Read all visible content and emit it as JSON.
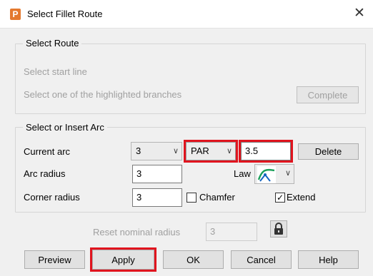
{
  "window": {
    "title": "Select Fillet Route",
    "icon_letter": "P",
    "close_glyph": "✕"
  },
  "select_route": {
    "legend": "Select Route",
    "start_line": "Select start line",
    "branches": "Select one of the highlighted branches",
    "complete_label": "Complete"
  },
  "select_arc": {
    "legend": "Select or Insert Arc",
    "current_arc_label": "Current arc",
    "current_arc_value": "3",
    "mode_value": "PAR",
    "param_value": "3.5",
    "delete_label": "Delete",
    "arc_radius_label": "Arc radius",
    "arc_radius_value": "3",
    "law_label": "Law",
    "corner_radius_label": "Corner radius",
    "corner_radius_value": "3",
    "chamfer_label": "Chamfer",
    "chamfer_checked": false,
    "extend_label": "Extend",
    "extend_checked": true
  },
  "reset": {
    "label": "Reset nominal radius",
    "value": "3"
  },
  "buttons": {
    "preview": "Preview",
    "apply": "Apply",
    "ok": "OK",
    "cancel": "Cancel",
    "help": "Help"
  },
  "colors": {
    "highlight": "#e0141e",
    "app_icon": "#e4792e"
  },
  "icons": {
    "law": "law-curve-icon",
    "lock": "padlock-icon",
    "chevron": "chevron-down-icon"
  }
}
